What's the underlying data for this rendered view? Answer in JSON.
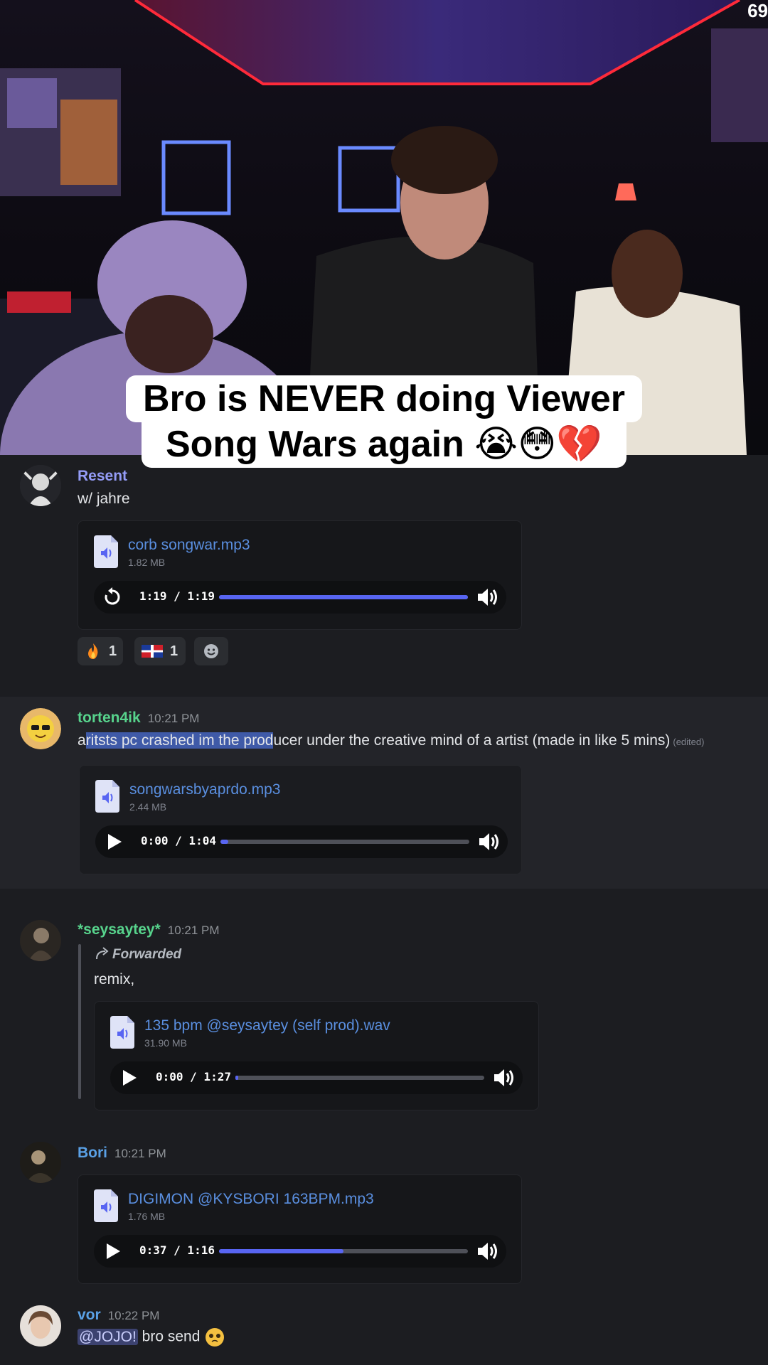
{
  "video": {
    "corner_counter": "69",
    "caption_line1": "Bro is NEVER doing Viewer",
    "caption_line2": "Song Wars again 😭😳💔"
  },
  "messages": [
    {
      "author": "Resent",
      "author_color": "#949cf7",
      "text": "w/ jahre",
      "attachment": {
        "filename": "corb songwar.mp3",
        "size": "1.82 MB",
        "time": "1:19 / 1:19",
        "progress": 1.0,
        "state": "replay"
      },
      "reactions": [
        {
          "emoji": "fire-emoji",
          "count": "1"
        },
        {
          "emoji": "dominican-flag-emoji",
          "count": "1"
        }
      ]
    },
    {
      "author": "torten4ik",
      "author_color": "#57d38c",
      "time": "10:21 PM",
      "text_pre": "a",
      "text_selected": "ritsts pc crashed im the prod",
      "text_post": "ucer under the creative mind of a artist (made in like 5 mins)",
      "edited": "(edited)",
      "attachment": {
        "filename": "songwarsbyaprdo.mp3",
        "size": "2.44 MB",
        "time": "0:00 / 1:04",
        "progress": 0.03,
        "state": "play"
      }
    },
    {
      "author": "*seysaytey*",
      "author_color": "#57d38c",
      "time": "10:21 PM",
      "forwarded_label": "Forwarded",
      "text": "remix,",
      "attachment": {
        "filename": "135 bpm @seysaytey (self prod).wav",
        "size": "31.90 MB",
        "time": "0:00 / 1:27",
        "progress": 0.01,
        "state": "play"
      }
    },
    {
      "author": "Bori",
      "author_color": "#5aa1e6",
      "time": "10:21 PM",
      "attachment": {
        "filename": "DIGIMON @KYSBORI 163BPM.mp3",
        "size": "1.76 MB",
        "time": "0:37 / 1:16",
        "progress": 0.5,
        "state": "play"
      }
    },
    {
      "author": "vor",
      "author_color": "#5aa1e6",
      "time": "10:22 PM",
      "mention": "@JOJO!",
      "text": " bro send"
    }
  ],
  "colors": {
    "accent": "#5865f2",
    "link": "#5a8fe0",
    "selection": "#3f5aa8"
  }
}
